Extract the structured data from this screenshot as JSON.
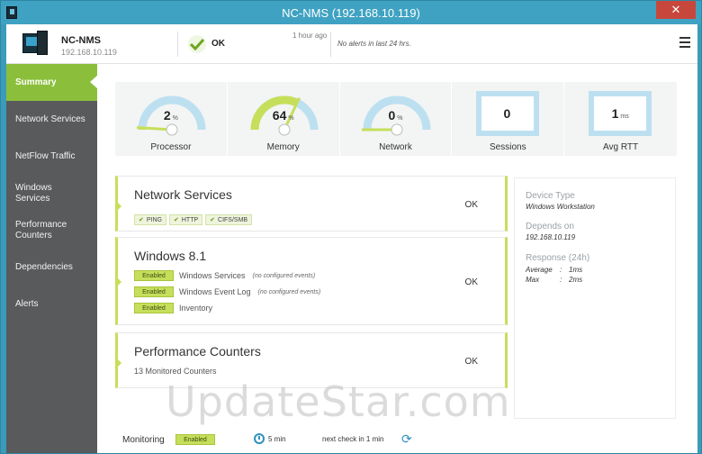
{
  "window": {
    "title": "NC-NMS (192.168.10.119)",
    "close_glyph": "✕"
  },
  "header": {
    "device_name": "NC-NMS",
    "device_ip": "192.168.10.119",
    "status": "OK",
    "last_check": "1 hour ago",
    "alerts_text": "No alerts in last 24 hrs."
  },
  "sidebar": {
    "items": [
      {
        "label": "Summary",
        "active": true
      },
      {
        "label": "Network Services"
      },
      {
        "label": "NetFlow Traffic"
      },
      {
        "label": "Windows Services"
      },
      {
        "label": "Performance Counters"
      },
      {
        "label": "Dependencies"
      },
      {
        "label": "Alerts"
      }
    ]
  },
  "gauges": [
    {
      "label": "Processor",
      "value": "2",
      "unit": "%",
      "level": 0.02
    },
    {
      "label": "Memory",
      "value": "64",
      "unit": "%",
      "level": 0.64
    },
    {
      "label": "Network",
      "value": "0",
      "unit": "%",
      "level": 0.0
    },
    {
      "label": "Sessions",
      "value": "0",
      "unit": ""
    },
    {
      "label": "Avg RTT",
      "value": "1",
      "unit": "ms"
    }
  ],
  "cards": {
    "network_services": {
      "title": "Network Services",
      "status": "OK",
      "tags": [
        "PING",
        "HTTP",
        "CIFS/SMB"
      ]
    },
    "windows": {
      "title": "Windows 8.1",
      "status": "OK",
      "rows": [
        {
          "badge": "Enabled",
          "name": "Windows Services",
          "note": "(no configured events)"
        },
        {
          "badge": "Enabled",
          "name": "Windows Event Log",
          "note": "(no configured events)"
        },
        {
          "badge": "Enabled",
          "name": "Inventory",
          "note": ""
        }
      ]
    },
    "performance": {
      "title": "Performance Counters",
      "status": "OK",
      "subtitle": "13 Monitored Counters"
    }
  },
  "details": {
    "device_type_label": "Device Type",
    "device_type": "Windows Workstation",
    "depends_on_label": "Depends on",
    "depends_on": "192.168.10.119",
    "response_label": "Response (24h)",
    "average_label": "Average",
    "average_value": "1ms",
    "max_label": "Max",
    "max_value": "2ms",
    "separator": ":"
  },
  "footer": {
    "monitoring_label": "Monitoring",
    "monitoring_badge": "Enabled",
    "interval": "5 min",
    "next_check": "next check in 1 min"
  },
  "watermark": "UpdateStar.com",
  "colors": {
    "accent_green": "#8bbf3b",
    "card_border": "#c6df5a",
    "gauge_track": "#bde0f1",
    "gauge_fill": "#c6df5a",
    "titlebar": "#3fa2c2",
    "sidebar_bg": "#585a5c"
  }
}
